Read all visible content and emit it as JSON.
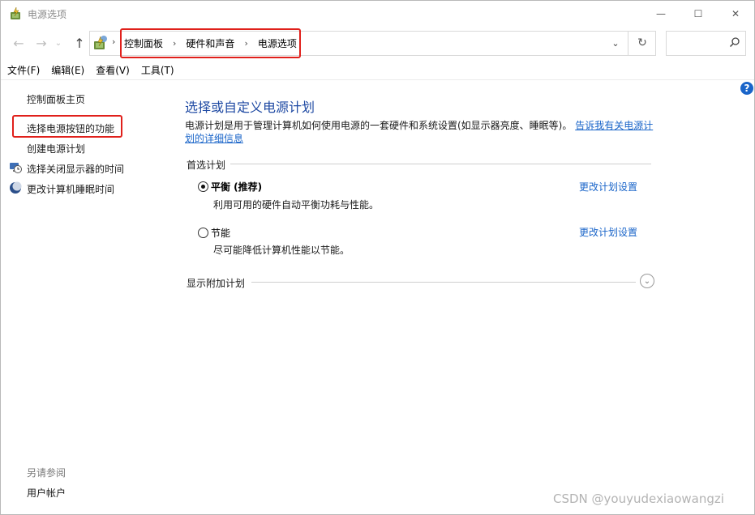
{
  "window": {
    "title": "电源选项",
    "controls": {
      "minimize": "—",
      "maximize": "☐",
      "close": "✕"
    }
  },
  "navbar": {
    "back_icon": "←",
    "forward_icon": "→",
    "recent_icon": "⌄",
    "up_icon": "↑",
    "breadcrumb": [
      "控制面板",
      "硬件和声音",
      "电源选项"
    ],
    "breadcrumb_sep": "›",
    "refresh_icon": "↻",
    "search_placeholder": ""
  },
  "menu": [
    "文件(F)",
    "编辑(E)",
    "查看(V)",
    "工具(T)"
  ],
  "left_pane": {
    "home": "控制面板主页",
    "links": [
      "选择电源按钮的功能",
      "创建电源计划",
      "选择关闭显示器的时间",
      "更改计算机睡眠时间"
    ],
    "see_also": "另请参阅",
    "user_accounts": "用户帐户"
  },
  "main": {
    "title": "选择或自定义电源计划",
    "description": "电源计划是用于管理计算机如何使用电源的一套硬件和系统设置(如显示器亮度、睡眠等)。",
    "description_link": "告诉我有关电源计划的详细信息",
    "preferred_label": "首选计划",
    "plans": [
      {
        "name": "平衡 (推荐)",
        "desc": "利用可用的硬件自动平衡功耗与性能。",
        "selected": true,
        "change": "更改计划设置"
      },
      {
        "name": "节能",
        "desc": "尽可能降低计算机性能以节能。",
        "selected": false,
        "change": "更改计划设置"
      }
    ],
    "more_plans_label": "显示附加计划"
  },
  "help_icon": "?",
  "watermark": "CSDN @youyudexiaowangzi",
  "colors": {
    "highlight_box": "#e0201b",
    "link": "#1a65c9",
    "title": "#1f4aa3"
  }
}
